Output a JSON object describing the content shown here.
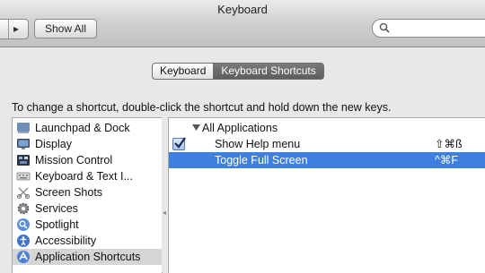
{
  "window": {
    "title": "Keyboard"
  },
  "toolbar": {
    "nav_arrow": "▸",
    "show_all_label": "Show All",
    "search_placeholder": ""
  },
  "tabs": [
    {
      "label": "Keyboard",
      "selected": false
    },
    {
      "label": "Keyboard Shortcuts",
      "selected": true
    }
  ],
  "instructions": "To change a shortcut, double-click the shortcut and hold down the new keys.",
  "sidebar": {
    "items": [
      {
        "label": "Launchpad & Dock",
        "icon": "launchpad-dock-icon"
      },
      {
        "label": "Display",
        "icon": "display-icon"
      },
      {
        "label": "Mission Control",
        "icon": "mission-control-icon"
      },
      {
        "label": "Keyboard & Text I...",
        "icon": "keyboard-icon"
      },
      {
        "label": "Screen Shots",
        "icon": "screenshot-icon"
      },
      {
        "label": "Services",
        "icon": "services-gear-icon"
      },
      {
        "label": "Spotlight",
        "icon": "spotlight-icon"
      },
      {
        "label": "Accessibility",
        "icon": "accessibility-icon"
      },
      {
        "label": "Application Shortcuts",
        "icon": "app-shortcuts-icon",
        "selected": true
      }
    ]
  },
  "shortcuts": {
    "group_label": "All Applications",
    "rows": [
      {
        "enabled": true,
        "name": "Show Help menu",
        "keys": "⇧⌘ß"
      },
      {
        "enabled": false,
        "name": "Toggle Full Screen",
        "keys": "^⌘F",
        "selected": true
      }
    ]
  },
  "colors": {
    "selection": "#3d80df",
    "sidebar_selection": "#d5d5d5",
    "active_tab": "#666666"
  }
}
